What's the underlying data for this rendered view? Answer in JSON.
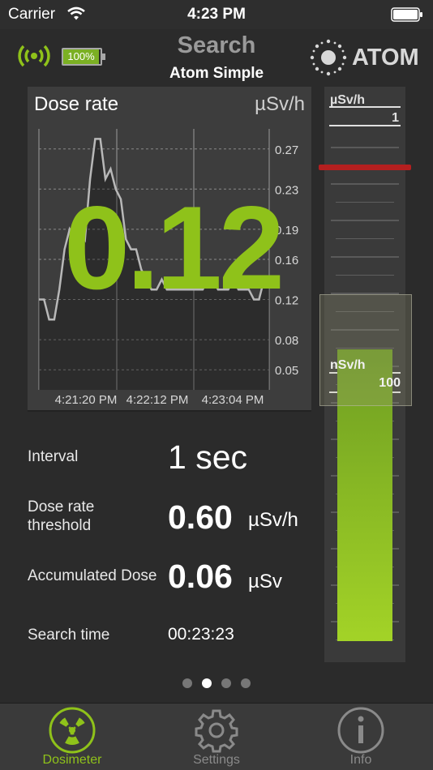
{
  "status_bar": {
    "carrier": "Carrier",
    "time": "4:23 PM"
  },
  "nav": {
    "title": "Search",
    "subtitle": "Atom Simple",
    "device_battery": "100%",
    "logo_text": "ATOM"
  },
  "chart": {
    "title": "Dose rate",
    "unit": "µSv/h",
    "current_value": "0.12",
    "y_ticks": [
      "0.27",
      "0.23",
      "0.19",
      "0.16",
      "0.12",
      "0.08",
      "0.05"
    ],
    "x_ticks": [
      "4:21:20 PM",
      "4:22:12 PM",
      "4:23:04 PM"
    ]
  },
  "chart_data": {
    "type": "area",
    "title": "Dose rate",
    "ylabel": "µSv/h",
    "ylim": [
      0.03,
      0.29
    ],
    "x": [
      "4:21:20 PM",
      "4:22:12 PM",
      "4:23:04 PM"
    ],
    "series": [
      {
        "values": [
          0.12,
          0.12,
          0.1,
          0.1,
          0.13,
          0.17,
          0.19,
          0.18,
          0.19,
          0.18,
          0.24,
          0.28,
          0.28,
          0.24,
          0.25,
          0.23,
          0.22,
          0.18,
          0.17,
          0.17,
          0.15,
          0.14,
          0.13,
          0.13,
          0.14,
          0.13,
          0.13,
          0.13,
          0.13,
          0.13,
          0.13,
          0.13,
          0.13,
          0.14,
          0.14,
          0.13,
          0.13,
          0.13,
          0.14,
          0.13,
          0.13,
          0.13,
          0.12,
          0.12,
          0.14,
          0.14
        ]
      }
    ],
    "grid": true
  },
  "scale": {
    "top_unit": "µSv/h",
    "top_value": "1",
    "lens_unit": "nSv/h",
    "lens_value": "100",
    "threshold_marker": 0.6,
    "level": 0.12
  },
  "info": {
    "interval_label": "Interval",
    "interval_value": "1 sec",
    "threshold_label_1": "Dose rate",
    "threshold_label_2": "threshold",
    "threshold_value": "0.60",
    "threshold_unit": "µSv/h",
    "accumulated_label": "Accumulated Dose",
    "accumulated_value": "0.06",
    "accumulated_unit": "µSv",
    "search_time_label": "Search time",
    "search_time_value": "00:23:23"
  },
  "tabs": [
    {
      "label": "Dosimeter",
      "icon": "radiation-icon",
      "active": true,
      "color": "#8fc21a"
    },
    {
      "label": "Settings",
      "icon": "gear-icon",
      "active": false,
      "color": "#8a8a8a"
    },
    {
      "label": "Info",
      "icon": "info-icon",
      "active": false,
      "color": "#8a8a8a"
    }
  ],
  "colors": {
    "accent": "#8fc21a",
    "threshold": "#b41f1f",
    "background": "#2b2b2b"
  }
}
